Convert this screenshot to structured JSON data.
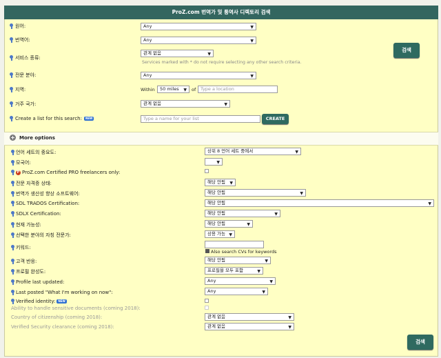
{
  "title": "ProZ.com 번역가 및 통역사 디렉토리 검색",
  "top": {
    "source_lang_label": "원어:",
    "source_lang_value": "Any",
    "target_lang_label": "번역어:",
    "target_lang_value": "Any",
    "service_label": "서비스 종류:",
    "service_value": "관계 없음",
    "service_hint": "Services marked with * do not require selecting any other search criteria.",
    "field_label": "전문 분야:",
    "field_value": "Any",
    "region_label": "지역:",
    "within_label": "Within",
    "within_value": "50 miles",
    "of_label": "of",
    "location_placeholder": "Type a location",
    "country_label": "거주 국가:",
    "country_value": "관계 없음",
    "list_label": "Create a list for this search:",
    "new_badge": "NEW",
    "list_placeholder": "Type a name for your list",
    "create_button": "CREATE",
    "search_button": "검색"
  },
  "more_options_label": "More options",
  "options": {
    "lang_pair_importance_label": "언어 세트의 중요도:",
    "lang_pair_importance_value": "상위 8 언어 세트 중에서",
    "native_label": "모국어:",
    "native_value": "",
    "pro_label": "ProZ.com Certified PRO freelancers only:",
    "pro_icon": "P",
    "credentials_label": "전문 자격증 상태:",
    "credentials_value": "해당 안됨",
    "productivity_label": "번역가 생산성 향상 소프트웨어:",
    "productivity_value": "해당 안됨",
    "trados_label": "SDL TRADOS Certification:",
    "trados_value": "해당 안됨",
    "sdlx_label": "SDLX Certification:",
    "sdlx_value": "해당 안됨",
    "availability_label": "현재 가능성:",
    "availability_value": "해당 안됨",
    "expertise_label": "선택한 분야의 자칭 전문가:",
    "expertise_value": "상용 가능",
    "keywords_label": "키워드:",
    "keywords_value": "",
    "also_search_cvs": "Also search CVs for keywords",
    "feedback_label": "고객 반응:",
    "feedback_value": "해당 안됨",
    "profile_complete_label": "프로필 완성도:",
    "profile_complete_value": "프로필을 모두 포함",
    "profile_updated_label": "Profile last updated:",
    "profile_updated_value": "Any",
    "last_posted_label": "Last posted \"What I'm working on now\":",
    "last_posted_value": "Any",
    "verified_label": "Verified identity:",
    "verified_badge": "NEW",
    "sensitive_label": "Ability to handle sensitive documents (coming 2018):",
    "citizenship_label": "Country of citizenship (coming 2018):",
    "citizenship_value": "관계 없음",
    "clearance_label": "Verified Security clearance (coming 2018):",
    "clearance_value": "관계 없음"
  },
  "bottom_search_button": "검색"
}
